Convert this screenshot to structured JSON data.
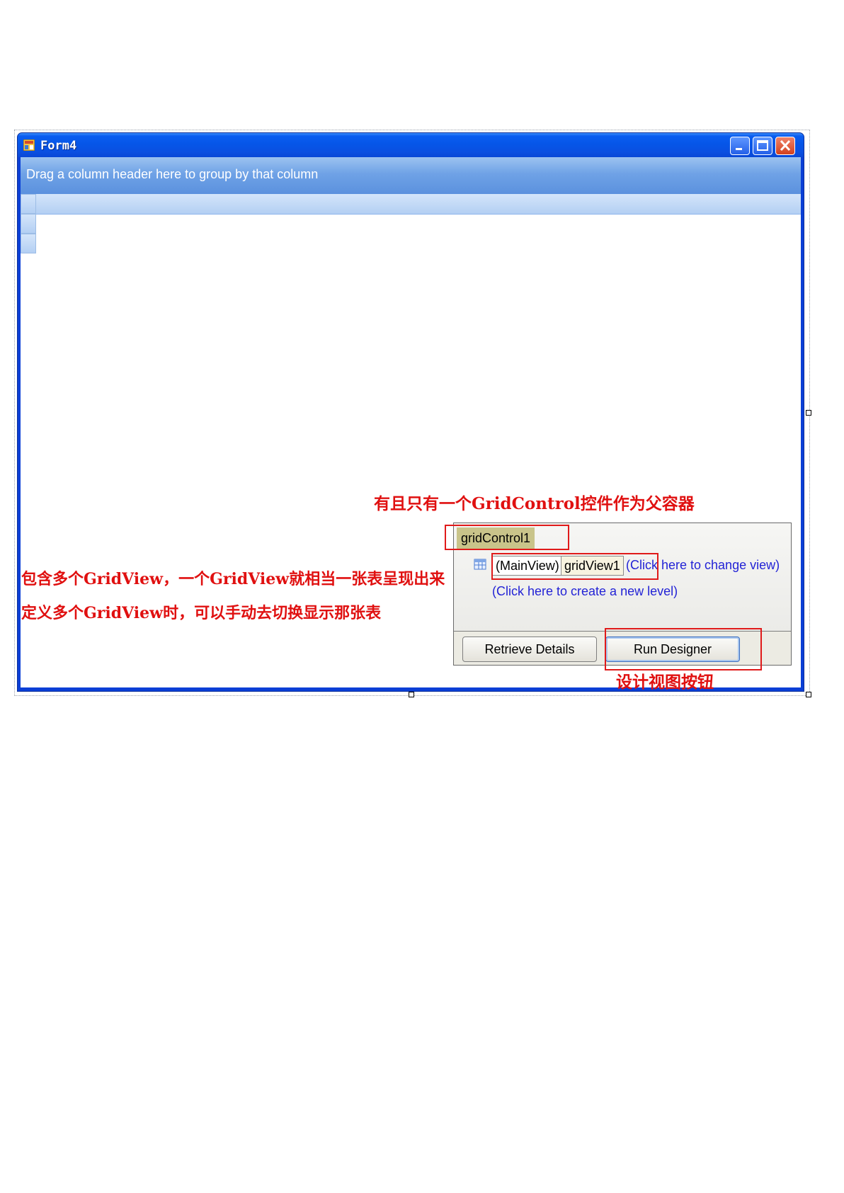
{
  "window": {
    "title": "Form4"
  },
  "grid": {
    "group_panel_text": "Drag a column header here to group by that column"
  },
  "annotations": {
    "top": "有且只有一个GridControl控件作为父容器",
    "left_line1": "包含多个GridView，一个GridView就相当一张表呈现出来",
    "left_line2": "定义多个GridView时，可以手动去切换显示那张表",
    "bottom": "设计视图按钮"
  },
  "level_designer": {
    "root_label": "gridControl1",
    "main_view_label": "(MainView)",
    "grid_view_label": "gridView1",
    "change_view_link": "(Click here to change view)",
    "create_level_link": "(Click here to create a new level)",
    "retrieve_button": "Retrieve Details",
    "run_designer_button": "Run Designer"
  },
  "colors": {
    "annotation_red": "#e01010",
    "titlebar_blue": "#0a5df0",
    "link_blue": "#2323d6"
  }
}
